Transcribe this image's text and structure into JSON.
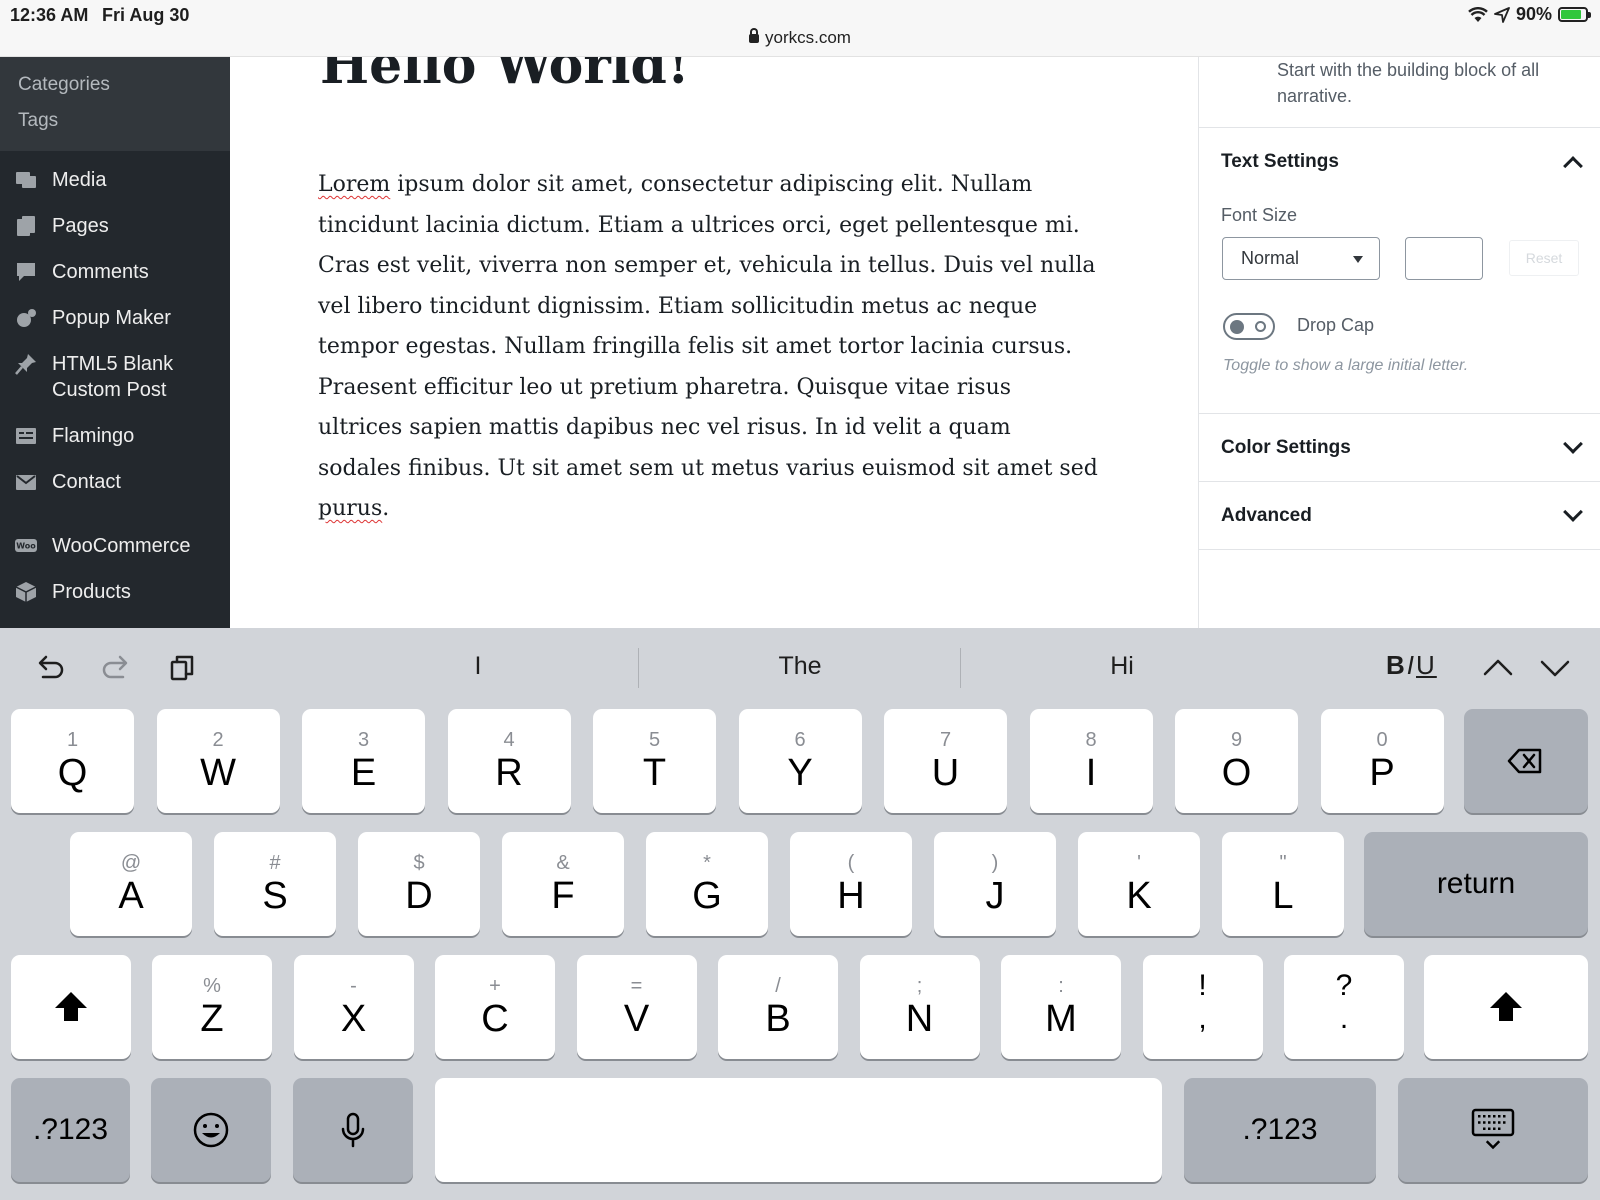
{
  "status": {
    "time": "12:36 AM",
    "date": "Fri Aug 30",
    "url": "yorkcs.com",
    "battery": "90%"
  },
  "sidebar": {
    "subitems": [
      "Categories",
      "Tags"
    ],
    "items": [
      {
        "label": "Media",
        "icon": "media-icon"
      },
      {
        "label": "Pages",
        "icon": "pages-icon"
      },
      {
        "label": "Comments",
        "icon": "comments-icon"
      },
      {
        "label": "Popup Maker",
        "icon": "popup-maker-icon"
      },
      {
        "label": "HTML5 Blank Custom Post",
        "icon": "pin-icon"
      },
      {
        "label": "Flamingo",
        "icon": "flamingo-icon"
      },
      {
        "label": "Contact",
        "icon": "mail-icon"
      },
      {
        "label": "WooCommerce",
        "icon": "woocommerce-icon"
      },
      {
        "label": "Products",
        "icon": "products-icon"
      }
    ]
  },
  "editor": {
    "title": "Hello World!",
    "paragraph_first_word": "Lorem",
    "paragraph_middle": " ipsum dolor sit amet, consectetur adipiscing elit. Nullam tincidunt lacinia dictum. Etiam a ultrices orci, eget pellentesque mi. Cras est velit, viverra non semper et, vehicula in tellus. Duis vel nulla vel libero tincidunt dignissim. Etiam sollicitudin metus ac neque tempor egestas. Nullam fringilla felis sit amet tortor lacinia cursus. Praesent efficitur leo ut pretium pharetra. Quisque vitae risus ultrices sapien mattis dapibus nec vel risus. In id velit a quam sodales finibus. Ut sit amet sem ut metus varius euismod sit amet sed ",
    "paragraph_last_word": "purus",
    "paragraph_end": "."
  },
  "panel": {
    "block_description": "Start with the building block of all narrative.",
    "text_settings": "Text Settings",
    "font_size_label": "Font Size",
    "font_size_value": "Normal",
    "reset_label": "Reset",
    "drop_cap_label": "Drop Cap",
    "drop_cap_help": "Toggle to show a large initial letter.",
    "color_settings": "Color Settings",
    "advanced": "Advanced"
  },
  "keyboard": {
    "suggestions": [
      "I",
      "The",
      "Hi"
    ],
    "format_label": "BIU",
    "row1": [
      {
        "main": "Q",
        "alt": "1"
      },
      {
        "main": "W",
        "alt": "2"
      },
      {
        "main": "E",
        "alt": "3"
      },
      {
        "main": "R",
        "alt": "4"
      },
      {
        "main": "T",
        "alt": "5"
      },
      {
        "main": "Y",
        "alt": "6"
      },
      {
        "main": "U",
        "alt": "7"
      },
      {
        "main": "I",
        "alt": "8"
      },
      {
        "main": "O",
        "alt": "9"
      },
      {
        "main": "P",
        "alt": "0"
      }
    ],
    "row2": [
      {
        "main": "A",
        "alt": "@"
      },
      {
        "main": "S",
        "alt": "#"
      },
      {
        "main": "D",
        "alt": "$"
      },
      {
        "main": "F",
        "alt": "&"
      },
      {
        "main": "G",
        "alt": "*"
      },
      {
        "main": "H",
        "alt": "("
      },
      {
        "main": "J",
        "alt": ")"
      },
      {
        "main": "K",
        "alt": "'"
      },
      {
        "main": "L",
        "alt": "\""
      }
    ],
    "row3": [
      {
        "main": "Z",
        "alt": "%"
      },
      {
        "main": "X",
        "alt": "-"
      },
      {
        "main": "C",
        "alt": "+"
      },
      {
        "main": "V",
        "alt": "="
      },
      {
        "main": "B",
        "alt": "/"
      },
      {
        "main": "N",
        "alt": ";"
      },
      {
        "main": "M",
        "alt": ":"
      },
      {
        "main": ",",
        "alt": "!"
      },
      {
        "main": ".",
        "alt": "?"
      }
    ],
    "return_label": "return",
    "numbers_label": ".?123"
  },
  "colors": {
    "sidebar_bg": "#23282d",
    "keyboard_bg": "#d1d4d9",
    "battery": "#30c73c"
  }
}
